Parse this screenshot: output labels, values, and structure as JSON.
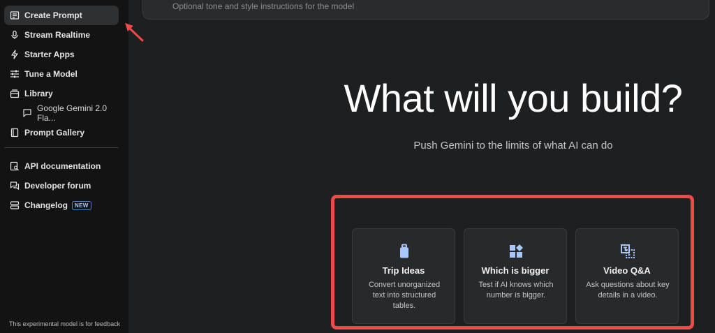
{
  "sidebar": {
    "items": [
      {
        "label": "Create Prompt",
        "icon": "create-prompt-icon"
      },
      {
        "label": "Stream Realtime",
        "icon": "microphone-icon"
      },
      {
        "label": "Starter Apps",
        "icon": "bolt-icon"
      },
      {
        "label": "Tune a Model",
        "icon": "tune-icon"
      },
      {
        "label": "Library",
        "icon": "library-icon"
      },
      {
        "label": "Google Gemini 2.0 Fla...",
        "icon": "chat-icon"
      },
      {
        "label": "Prompt Gallery",
        "icon": "book-icon"
      },
      {
        "label": "API documentation",
        "icon": "doc-search-icon"
      },
      {
        "label": "Developer forum",
        "icon": "forum-icon"
      },
      {
        "label": "Changelog",
        "icon": "changelog-icon",
        "badge": "NEW"
      }
    ],
    "footer": "This experimental model is for feedback"
  },
  "topbar": {
    "placeholder": "Optional tone and style instructions for the model"
  },
  "hero": {
    "title": "What will you build?",
    "subtitle": "Push Gemini to the limits of what AI can do"
  },
  "cards": [
    {
      "title": "Trip Ideas",
      "description": "Convert unorganized text into structured tables.",
      "icon": "luggage-icon"
    },
    {
      "title": "Which is bigger",
      "description": "Test if AI knows which number is bigger.",
      "icon": "shapes-icon"
    },
    {
      "title": "Video Q&A",
      "description": "Ask questions about key details in a video.",
      "icon": "video-qa-icon"
    }
  ],
  "colors": {
    "background": "#1e1f20",
    "sidebar": "#131314",
    "accent_icon": "#a8c7fa",
    "highlight_annotation": "#ee4a4a"
  }
}
